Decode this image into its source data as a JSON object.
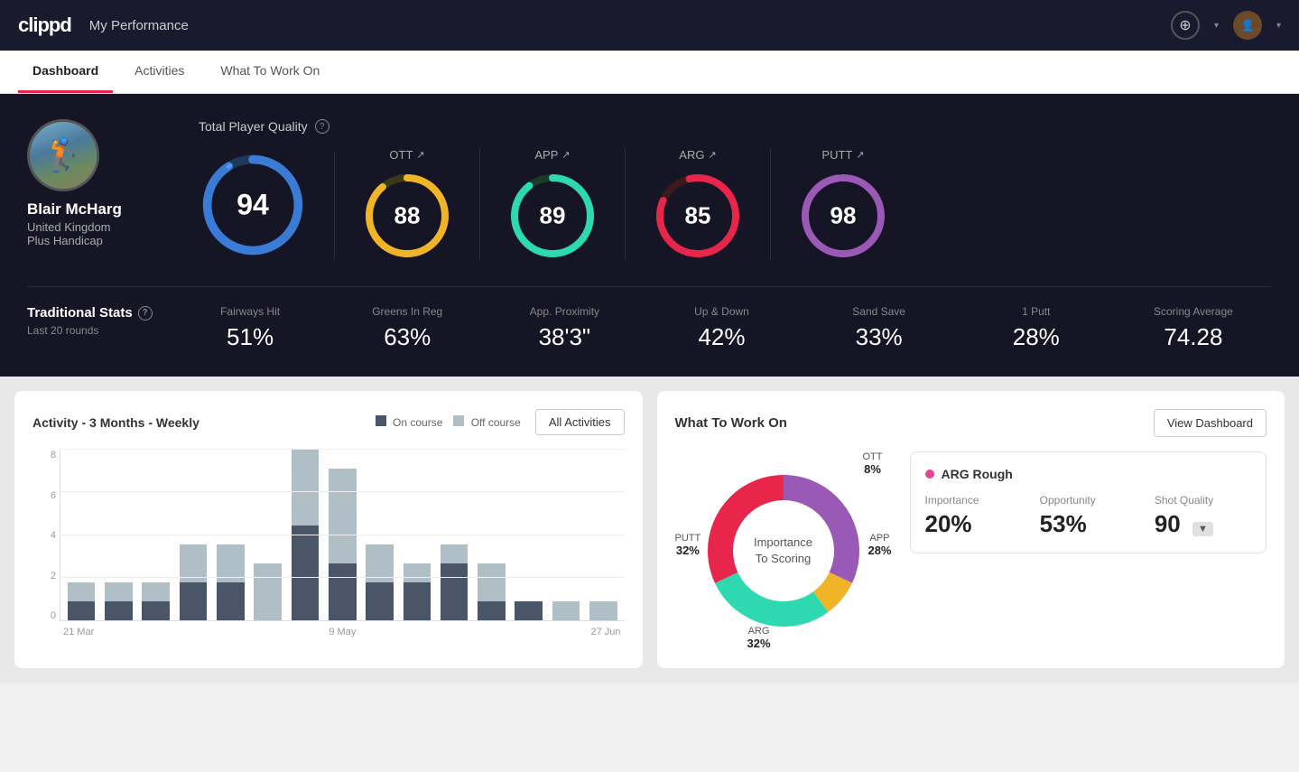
{
  "app": {
    "logo": "clippd",
    "nav_title": "My Performance"
  },
  "tabs": [
    {
      "label": "Dashboard",
      "active": true
    },
    {
      "label": "Activities",
      "active": false
    },
    {
      "label": "What To Work On",
      "active": false
    }
  ],
  "player": {
    "name": "Blair McHarg",
    "country": "United Kingdom",
    "handicap": "Plus Handicap"
  },
  "total_quality": {
    "label": "Total Player Quality",
    "score": 94
  },
  "category_scores": [
    {
      "label": "OTT",
      "value": 88,
      "color": "#f0b429",
      "trail": "#3a3a2a"
    },
    {
      "label": "APP",
      "value": 89,
      "color": "#2ed8b0",
      "trail": "#1a2a2a"
    },
    {
      "label": "ARG",
      "value": 85,
      "color": "#e8254a",
      "trail": "#2a1a1a"
    },
    {
      "label": "PUTT",
      "value": 98,
      "color": "#9b59b6",
      "trail": "#2a1a2a"
    }
  ],
  "traditional_stats": {
    "label": "Traditional Stats",
    "sub": "Last 20 rounds",
    "items": [
      {
        "name": "Fairways Hit",
        "value": "51%"
      },
      {
        "name": "Greens In Reg",
        "value": "63%"
      },
      {
        "name": "App. Proximity",
        "value": "38'3\""
      },
      {
        "name": "Up & Down",
        "value": "42%"
      },
      {
        "name": "Sand Save",
        "value": "33%"
      },
      {
        "name": "1 Putt",
        "value": "28%"
      },
      {
        "name": "Scoring Average",
        "value": "74.28"
      }
    ]
  },
  "activity_chart": {
    "title": "Activity - 3 Months - Weekly",
    "legend_on_course": "On course",
    "legend_off_course": "Off course",
    "all_activities_btn": "All Activities",
    "x_labels": [
      "21 Mar",
      "9 May",
      "27 Jun"
    ],
    "y_labels": [
      "8",
      "6",
      "4",
      "2",
      "0"
    ],
    "bars": [
      {
        "on": 1,
        "off": 1
      },
      {
        "on": 1,
        "off": 1
      },
      {
        "on": 1,
        "off": 1
      },
      {
        "on": 2,
        "off": 2
      },
      {
        "on": 2,
        "off": 2
      },
      {
        "on": 0,
        "off": 3
      },
      {
        "on": 5,
        "off": 4
      },
      {
        "on": 3,
        "off": 5
      },
      {
        "on": 2,
        "off": 2
      },
      {
        "on": 2,
        "off": 1
      },
      {
        "on": 3,
        "off": 1
      },
      {
        "on": 1,
        "off": 2
      },
      {
        "on": 1,
        "off": 0
      },
      {
        "on": 0,
        "off": 1
      },
      {
        "on": 0,
        "off": 1
      }
    ]
  },
  "what_to_work_on": {
    "title": "What To Work On",
    "view_dashboard_btn": "View Dashboard",
    "donut_center_line1": "Importance",
    "donut_center_line2": "To Scoring",
    "segments": [
      {
        "label": "OTT",
        "pct": "8%",
        "color": "#f0b429"
      },
      {
        "label": "APP",
        "pct": "28%",
        "color": "#2ed8b0"
      },
      {
        "label": "ARG",
        "pct": "32%",
        "color": "#e8254a"
      },
      {
        "label": "PUTT",
        "pct": "32%",
        "color": "#9b59b6"
      }
    ],
    "card": {
      "title": "ARG Rough",
      "dot_color": "#e84393",
      "metrics": [
        {
          "label": "Importance",
          "value": "20%"
        },
        {
          "label": "Opportunity",
          "value": "53%"
        },
        {
          "label": "Shot Quality",
          "value": "90",
          "badge": "▼"
        }
      ]
    }
  }
}
